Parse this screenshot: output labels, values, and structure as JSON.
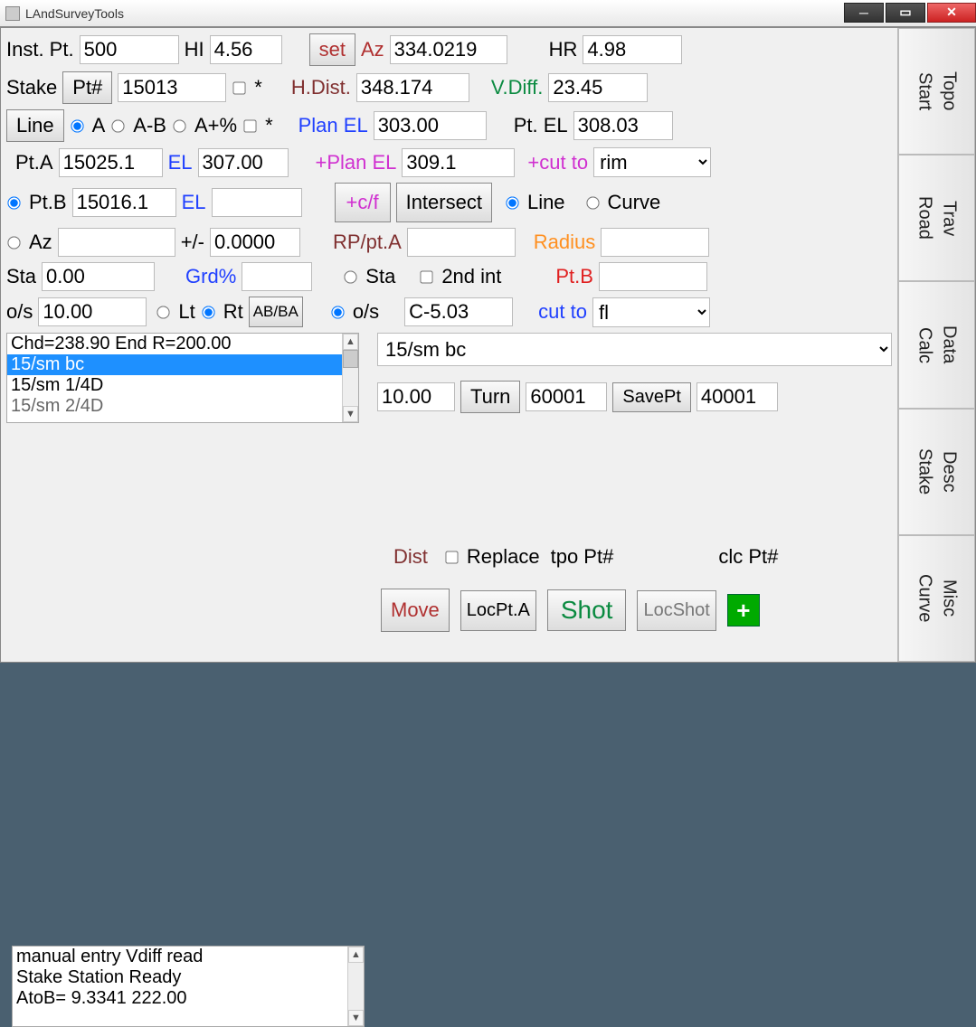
{
  "title": "LAndSurveyTools",
  "tabs": [
    "Topo\nStart",
    "Trav\nRoad",
    "Data\nCalc",
    "Desc\nStake",
    "Misc\nCurve"
  ],
  "r1": {
    "instpt": "Inst. Pt.",
    "instpt_v": "500",
    "hi": "HI",
    "hi_v": "4.56",
    "set": "set",
    "az": "Az",
    "az_v": "334.0219",
    "hr": "HR",
    "hr_v": "4.98"
  },
  "r2": {
    "stake": "Stake",
    "ptnum": "Pt#",
    "ptnum_v": "15013",
    "star": "*",
    "hdist": "H.Dist.",
    "hdist_v": "348.174",
    "vdiff": "V.Diff.",
    "vdiff_v": "23.45"
  },
  "r3": {
    "line": "Line",
    "a": "A",
    "ab": "A-B",
    "apc": "A+%",
    "star": "*",
    "planel": "Plan EL",
    "planel_v": "303.00",
    "ptel": "Pt. EL",
    "ptel_v": "308.03"
  },
  "r4": {
    "pta": "Pt.A",
    "pta_v": "15025.1",
    "el": "EL",
    "el_v": "307.00",
    "pplanel": "+Plan EL",
    "pplanel_v": "309.1",
    "pcut": "+cut to",
    "pcut_v": "rim"
  },
  "r5": {
    "ptb": "Pt.B",
    "ptb_v": "15016.1",
    "el": "EL",
    "el_v": "",
    "cf": "+c/f",
    "intersect": "Intersect",
    "line": "Line",
    "curve": "Curve"
  },
  "r6": {
    "az": "Az",
    "az_v": "",
    "pmlbl": "+/-",
    "pm_v": "0.0000",
    "rp": "RP/pt.A",
    "rp_v": "",
    "radius": "Radius",
    "radius_v": ""
  },
  "r7": {
    "sta": "Sta",
    "sta_v": "0.00",
    "grd": "Grd%",
    "grd_v": "",
    "sta2": "Sta",
    "secint": "2nd int",
    "ptb": "Pt.B",
    "ptb_v": ""
  },
  "r8": {
    "os": "o/s",
    "os_v": "10.00",
    "lt": "Lt",
    "rt": "Rt",
    "abba": "AB/BA",
    "os2": "o/s",
    "c503": "C-5.03",
    "cut": "cut to",
    "cut_v": "fl"
  },
  "list": {
    "items": [
      "Chd=238.90 End R=200.00",
      "15/sm bc",
      "15/sm 1/4D",
      "15/sm 2/4D"
    ],
    "sel": 1
  },
  "combo": "15/sm bc",
  "r10": {
    "d": "10.00",
    "turn": "Turn",
    "t": "60001",
    "save": "SavePt",
    "s": "40001"
  },
  "r11": {
    "dist": "Dist",
    "replace": "Replace",
    "tpo": "tpo Pt#",
    "clc": "clc Pt#"
  },
  "r12": {
    "move": "Move",
    "locpta": "LocPt.A",
    "shot": "Shot",
    "locshot": "LocShot"
  },
  "msgs": [
    "manual entry Vdiff read",
    "Stake Station Ready",
    "AtoB= 9.3341  222.00"
  ]
}
